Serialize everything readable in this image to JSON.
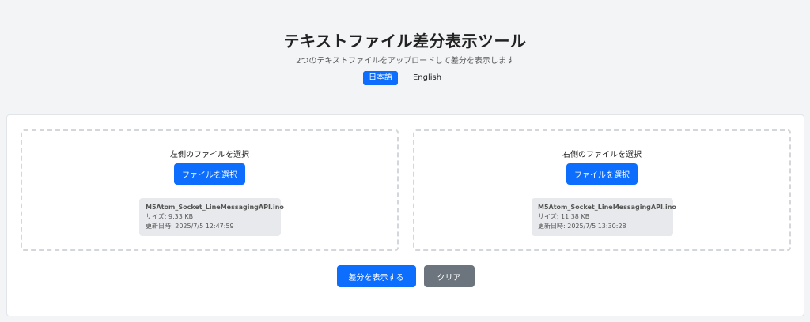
{
  "header": {
    "title": "テキストファイル差分表示ツール",
    "subtitle": "2つのテキストファイルをアップロードして差分を表示します",
    "languages": [
      {
        "label": "日本語",
        "active": true
      },
      {
        "label": "English",
        "active": false
      }
    ]
  },
  "left": {
    "label": "左側のファイルを選択",
    "button": "ファイルを選択",
    "file": {
      "name": "M5Atom_Socket_LineMessagingAPI.ino",
      "size": "サイズ: 9.33 KB",
      "modified": "更新日時: 2025/7/5 12:47:59"
    }
  },
  "right": {
    "label": "右側のファイルを選択",
    "button": "ファイルを選択",
    "file": {
      "name": "M5Atom_Socket_LineMessagingAPI.ino",
      "size": "サイズ: 11.38 KB",
      "modified": "更新日時: 2025/7/5 13:30:28"
    }
  },
  "actions": {
    "diff": "差分を表示する",
    "clear": "クリア"
  },
  "colors": {
    "primary": "#0d6efd",
    "secondary": "#6c757d",
    "background": "#f3f4f6"
  }
}
